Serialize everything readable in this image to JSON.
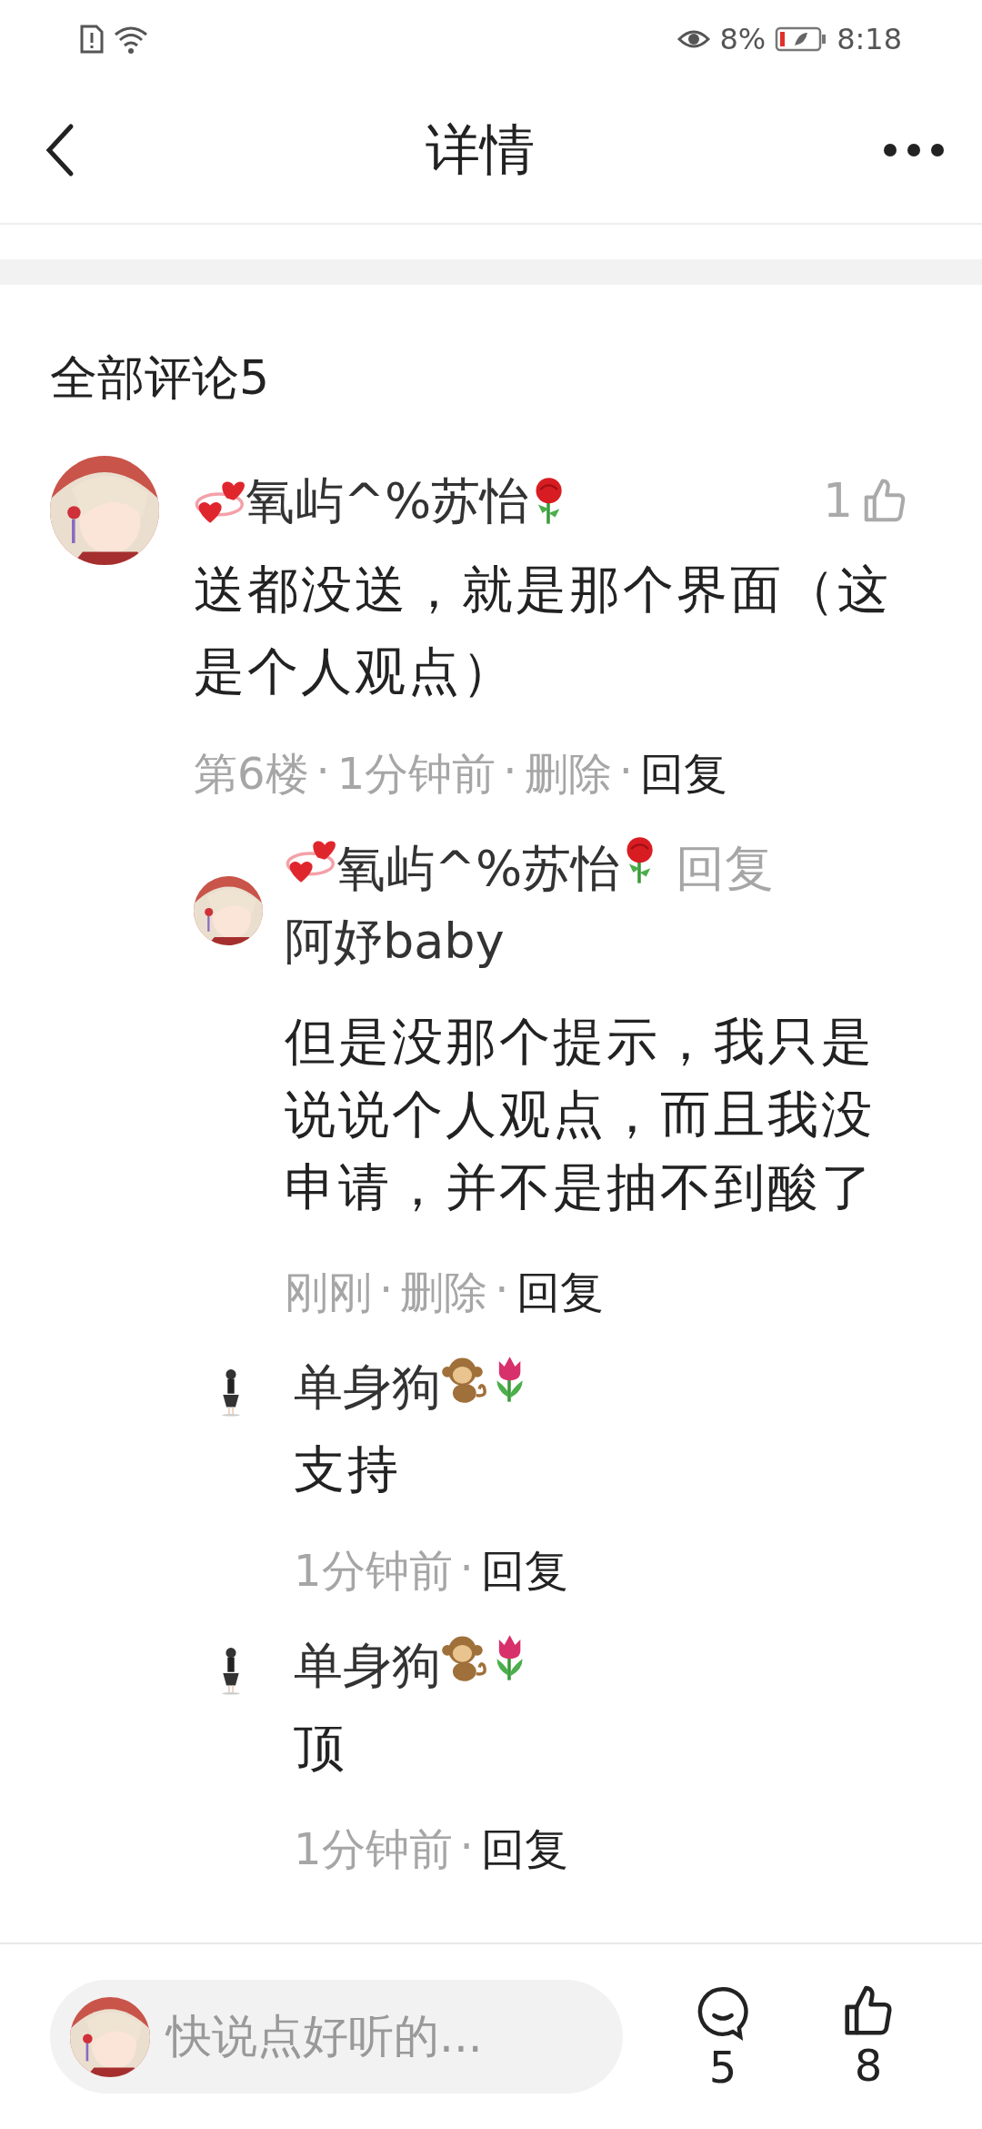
{
  "status_bar": {
    "battery": "8%",
    "time": "8:18"
  },
  "header": {
    "title": "详情"
  },
  "comments_section": {
    "title": "全部评论5",
    "separator": "·",
    "comment": {
      "author": {
        "name": "氧屿^%苏怡",
        "kind": "hearts-rose"
      },
      "likes": "1",
      "text": "送都没送，就是那个界面（这是个人观点）",
      "meta": [
        "第6楼",
        "1分钟前",
        "删除"
      ],
      "reply_action": "回复"
    },
    "replies": [
      {
        "author": {
          "name": "氧屿^%苏怡",
          "kind": "hearts-rose"
        },
        "avatar": {
          "kind": "girl"
        },
        "reply_label": "回复",
        "reply_to": "阿妤baby",
        "text": "但是没那个提示，我只是说说个人观点，而且我没申请，并不是抽不到酸了",
        "meta": [
          "刚刚",
          "删除"
        ],
        "reply_action": "回复"
      },
      {
        "author": {
          "name": "单身狗",
          "kind": "monkey-tulip"
        },
        "avatar": {
          "kind": "figure"
        },
        "text": "支持",
        "meta": [
          "1分钟前"
        ],
        "reply_action": "回复"
      },
      {
        "author": {
          "name": "单身狗",
          "kind": "monkey-tulip"
        },
        "avatar": {
          "kind": "figure"
        },
        "text": "顶",
        "meta": [
          "1分钟前"
        ],
        "reply_action": "回复"
      }
    ]
  },
  "bottom_bar": {
    "input": {
      "placeholder": "快说点好听的..."
    },
    "comment_count": "5",
    "like_count": "8"
  }
}
